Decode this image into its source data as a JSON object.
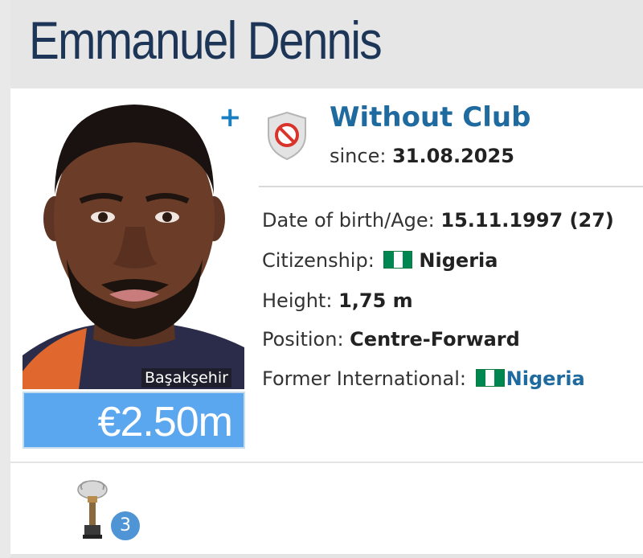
{
  "player": {
    "name": "Emmanuel Dennis",
    "photo_caption": "Başakşehir",
    "market_value": "€2.50m"
  },
  "club": {
    "name": "Without Club",
    "since_label": "since:",
    "since_date": "31.08.2025",
    "icon": "no-club-shield-icon"
  },
  "info": {
    "dob_label": "Date of birth/Age:",
    "dob_value": "15.11.1997 (27)",
    "citizenship_label": "Citizenship:",
    "citizenship_value": "Nigeria",
    "height_label": "Height:",
    "height_value": "1,75 m",
    "position_label": "Position:",
    "position_value": "Centre-Forward",
    "international_label": "Former International:",
    "international_value": "Nigeria"
  },
  "achievements": {
    "trophy_count": "3",
    "icon": "trophy-icon"
  },
  "colors": {
    "title": "#1d3557",
    "link": "#1f6a9e",
    "value_box": "#5aa7ef",
    "plus": "#1a7fc0",
    "flag_green": "#008751"
  }
}
